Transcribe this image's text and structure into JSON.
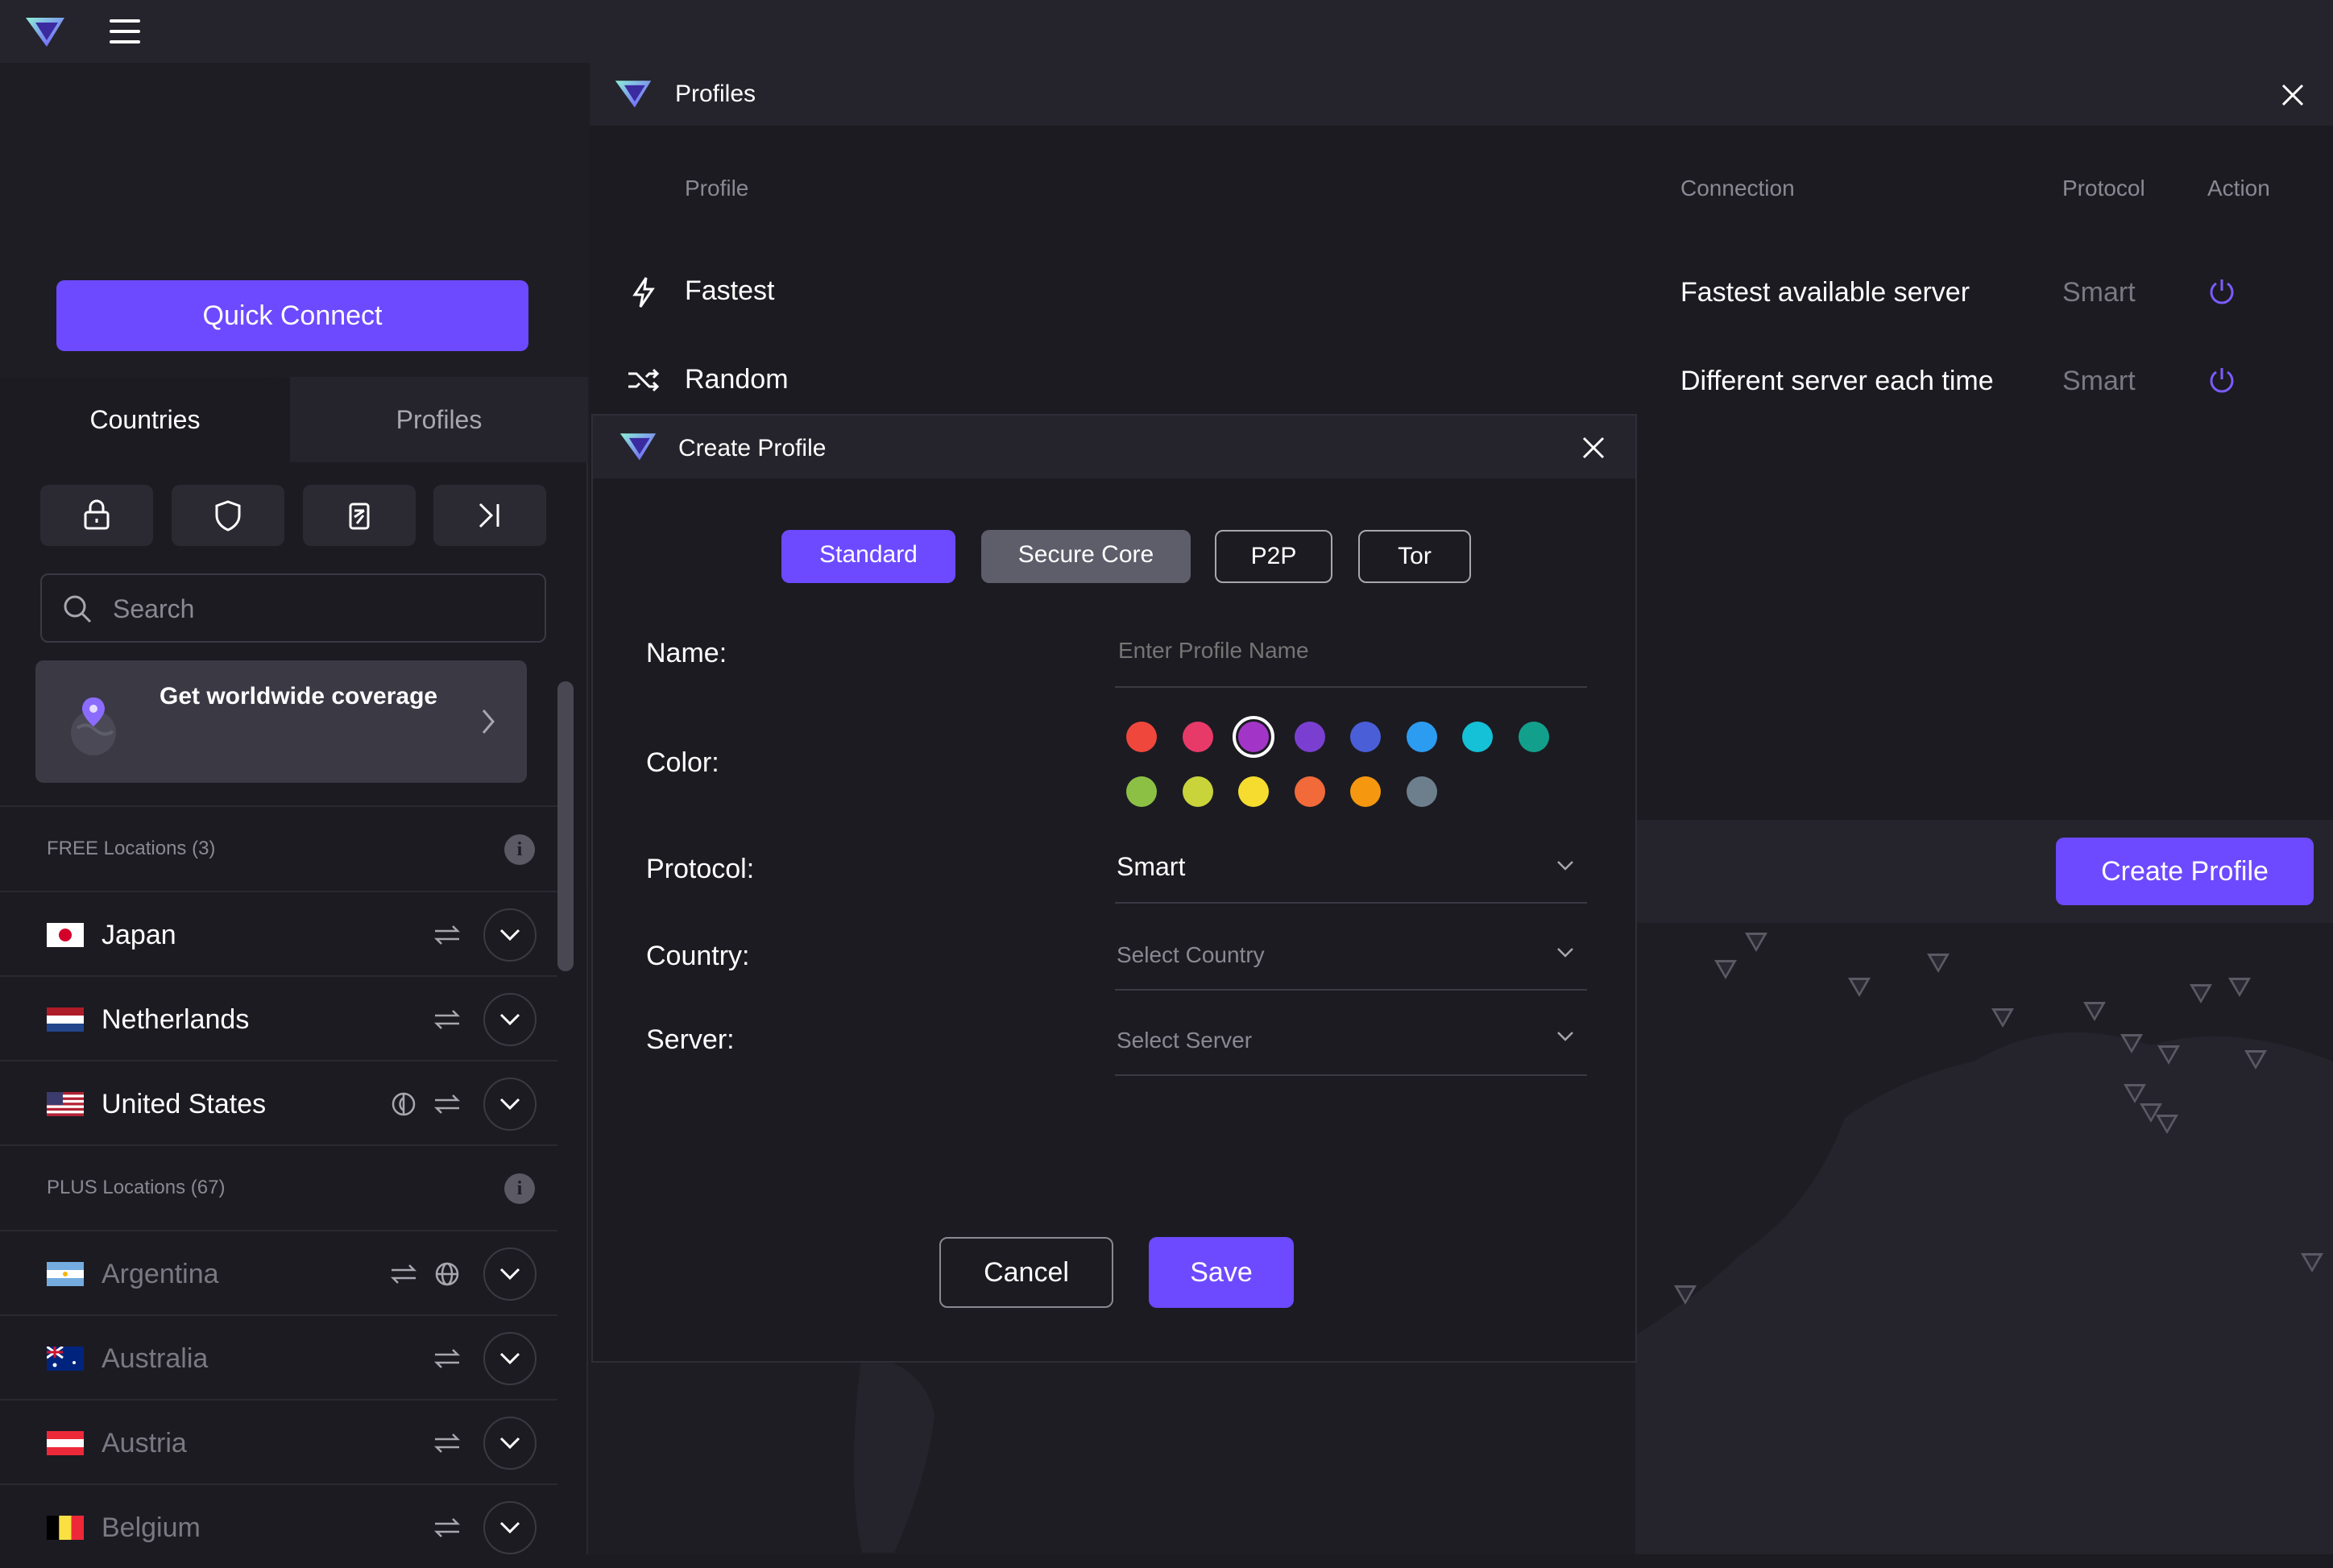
{
  "sidebar": {
    "quick_connect": "Quick Connect",
    "tabs": [
      "Countries",
      "Profiles"
    ],
    "search_placeholder": "Search",
    "promo": "Get worldwide coverage",
    "free_header": "FREE Locations (3)",
    "plus_header": "PLUS Locations (67)",
    "free_countries": [
      "Japan",
      "Netherlands",
      "United States"
    ],
    "plus_countries": [
      "Argentina",
      "Australia",
      "Austria",
      "Belgium"
    ]
  },
  "profiles_window": {
    "title": "Profiles",
    "columns": {
      "profile": "Profile",
      "connection": "Connection",
      "protocol": "Protocol",
      "action": "Action"
    },
    "rows": [
      {
        "name": "Fastest",
        "connection": "Fastest available server",
        "protocol": "Smart"
      },
      {
        "name": "Random",
        "connection": "Different server each time",
        "protocol": "Smart"
      }
    ],
    "create_button": "Create Profile"
  },
  "modal": {
    "title": "Create Profile",
    "segments": [
      "Standard",
      "Secure Core",
      "P2P",
      "Tor"
    ],
    "selected_segment": "Standard",
    "labels": {
      "name": "Name:",
      "color": "Color:",
      "protocol": "Protocol:",
      "country": "Country:",
      "server": "Server:"
    },
    "name_placeholder": "Enter Profile Name",
    "protocol_value": "Smart",
    "country_placeholder": "Select Country",
    "server_placeholder": "Select Server",
    "colors": [
      "#f0473c",
      "#e83a68",
      "#a235c8",
      "#7a3fd0",
      "#4a5ed8",
      "#2c9cf0",
      "#14c1d6",
      "#12a08c",
      "#8cc045",
      "#c8d43a",
      "#f5dc2e",
      "#f26a3a",
      "#f5980f",
      "#6d7f8c"
    ],
    "selected_color": "#a235c8",
    "cancel": "Cancel",
    "save": "Save"
  },
  "theme": {
    "accent": "#6d4aff",
    "bg": "#1c1b22"
  }
}
